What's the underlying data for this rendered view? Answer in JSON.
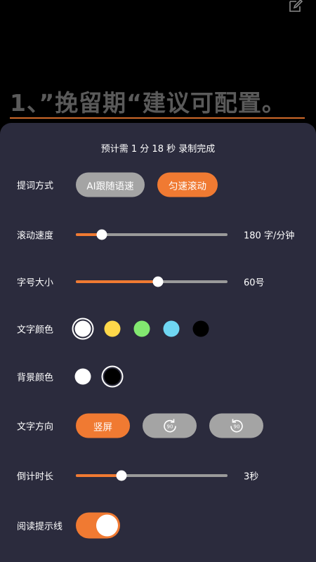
{
  "background": {
    "script_text": "1、”挽留期“建议可配置。"
  },
  "panel": {
    "estimate": "预计需 1 分 18 秒 录制完成",
    "prompt_mode": {
      "label": "提词方式",
      "options": [
        "AI跟随语速",
        "匀速滚动"
      ],
      "selected": "匀速滚动"
    },
    "scroll_speed": {
      "label": "滚动速度",
      "value_text": "180 字/分钟",
      "level": 0.17
    },
    "font_size": {
      "label": "字号大小",
      "value_text": "60号",
      "level": 0.54
    },
    "text_color": {
      "label": "文字颜色",
      "colors": [
        "#ffffff",
        "#ffd84a",
        "#82e870",
        "#6fd6f2",
        "#000000"
      ],
      "selected_index": 0
    },
    "bg_color": {
      "label": "背景颜色",
      "colors": [
        "#ffffff",
        "#000000"
      ],
      "selected_index": 1
    },
    "text_direction": {
      "label": "文字方向",
      "options": [
        "竖屏",
        "rotate-right-90-icon",
        "rotate-left-90-icon"
      ],
      "selected": "竖屏",
      "rotate_badge": "90"
    },
    "countdown": {
      "label": "倒计时长",
      "value_text": "3秒",
      "level": 0.3
    },
    "guide_line": {
      "label": "阅读提示线",
      "enabled": true
    }
  },
  "accent_color": "#f07a32"
}
